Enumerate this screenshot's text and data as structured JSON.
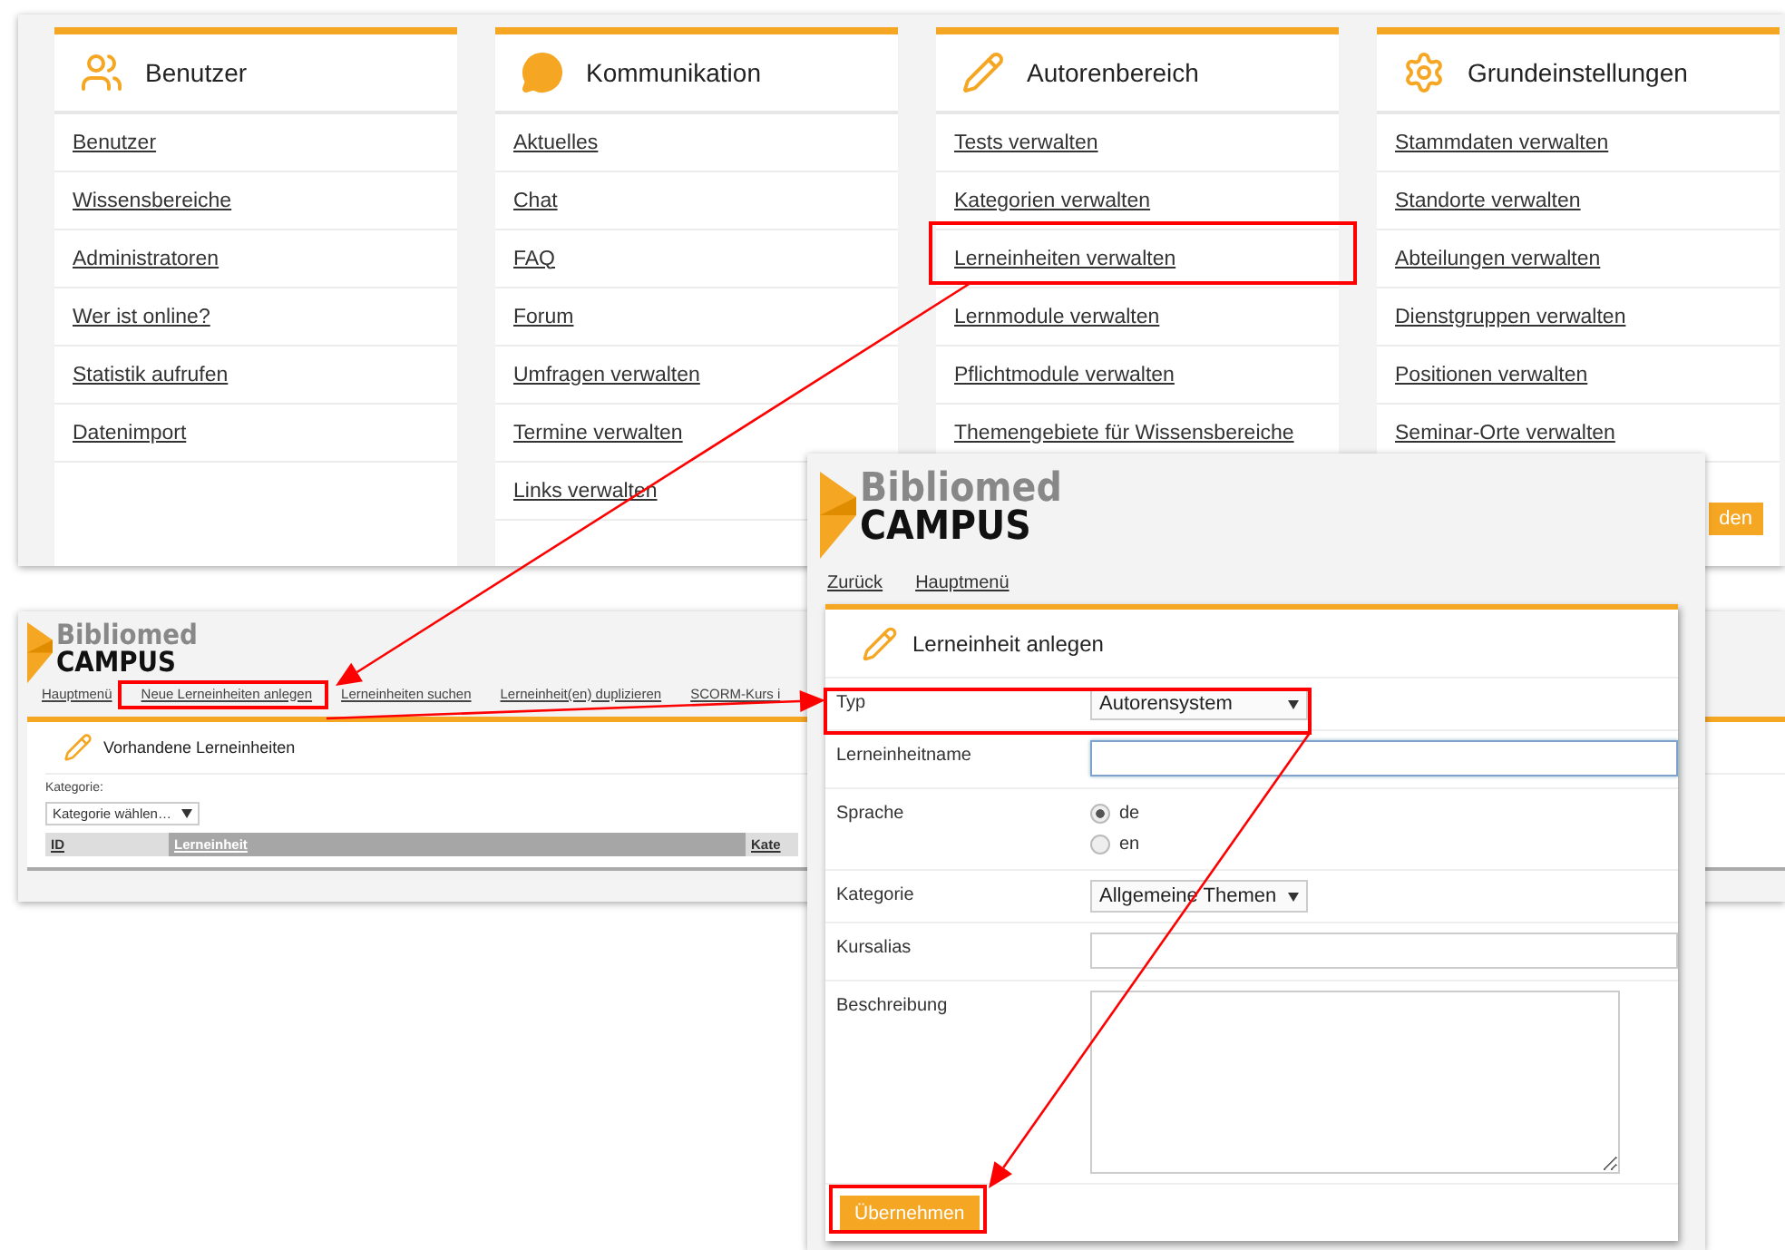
{
  "main_menu": {
    "columns": [
      {
        "kind": "users",
        "title": "Benutzer",
        "items": [
          "Benutzer",
          "Wissensbereiche",
          "Administratoren",
          "Wer ist online?",
          "Statistik aufrufen",
          "Datenimport"
        ]
      },
      {
        "kind": "chat",
        "title": "Kommunikation",
        "items": [
          "Aktuelles",
          "Chat",
          "FAQ",
          "Forum",
          "Umfragen verwalten",
          "Termine verwalten",
          "Links verwalten"
        ]
      },
      {
        "kind": "pencil",
        "title": "Autorenbereich",
        "items": [
          "Tests verwalten",
          "Kategorien verwalten",
          "Lerneinheiten verwalten",
          "Lernmodule verwalten",
          "Pflichtmodule verwalten",
          "Themengebiete für Wissensbereiche"
        ]
      },
      {
        "kind": "gear",
        "title": "Grundeinstellungen",
        "items": [
          "Stammdaten verwalten",
          "Standorte verwalten",
          "Abteilungen verwalten",
          "Dienstgruppen verwalten",
          "Positionen verwalten",
          "Seminar-Orte verwalten"
        ],
        "button": "den"
      }
    ]
  },
  "lerneinheiten_page": {
    "logo": {
      "line1": "Bibliomed",
      "line2": "CAMPUS"
    },
    "nav": [
      "Hauptmenü",
      "Neue Lerneinheiten anlegen",
      "Lerneinheiten suchen",
      "Lerneinheit(en) duplizieren",
      "SCORM-Kurs i"
    ],
    "card_title": "Vorhandene Lerneinheiten",
    "filter_label": "Kategorie:",
    "filter_value": "Kategorie wählen…",
    "table": {
      "columns": [
        {
          "label": "ID",
          "selected": false
        },
        {
          "label": "Lerneinheit",
          "selected": true
        },
        {
          "label": "Kate",
          "selected": false
        }
      ]
    }
  },
  "anlegen_page": {
    "logo": {
      "line1": "Bibliomed",
      "line2": "CAMPUS"
    },
    "nav": [
      "Zurück",
      "Hauptmenü"
    ],
    "card_title": "Lerneinheit anlegen",
    "fields": [
      {
        "kind": "select",
        "label": "Typ",
        "value": "Autorensystem"
      },
      {
        "kind": "text",
        "label": "Lerneinheitname",
        "focused": true
      },
      {
        "kind": "radio",
        "label": "Sprache",
        "options": [
          {
            "label": "de",
            "selected": true
          },
          {
            "label": "en",
            "selected": false
          }
        ]
      },
      {
        "kind": "select",
        "label": "Kategorie",
        "value": "Allgemeine Themen"
      },
      {
        "kind": "text",
        "label": "Kursalias",
        "focused": false
      },
      {
        "kind": "textarea",
        "label": "Beschreibung"
      }
    ],
    "submit": "Übernehmen"
  }
}
